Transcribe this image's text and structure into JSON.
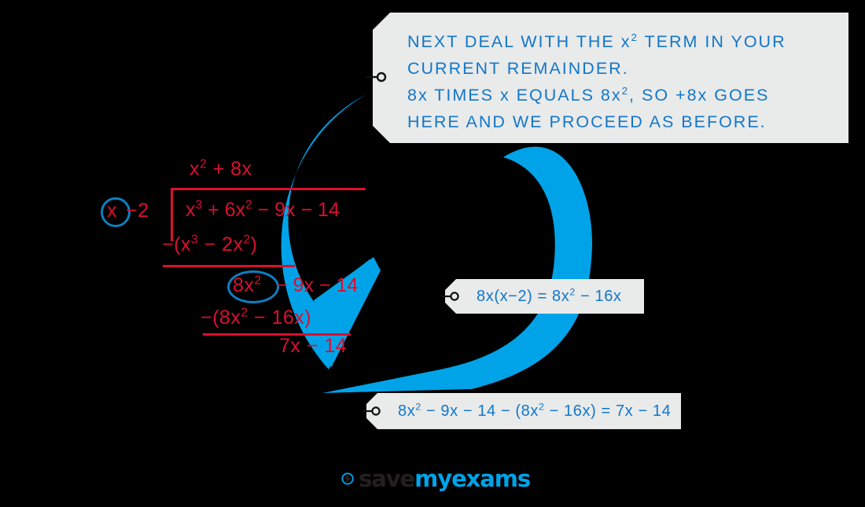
{
  "theme": {
    "background": "#000000",
    "math_red": "#D81030",
    "accent_blue": "#00A3E8",
    "circle_blue": "#0E7FC1",
    "tag_background": "#E9EAEA",
    "tag_text_blue": "#1277C8"
  },
  "division": {
    "divisor": "x − 2",
    "divisor_circled_part": "x",
    "divisor_rest": "−2",
    "quotient": "x² + 8x",
    "dividend": "x³ + 6x² − 9x − 14",
    "subtract_step_1": "−(x³ − 2x²)",
    "remainder_1_circled": "8x²",
    "remainder_1_rest": "− 9x − 14",
    "subtract_step_2": "−(8x² − 16x)",
    "remainder_2": "7x − 14"
  },
  "callouts": {
    "main": {
      "line1": "NEXT DEAL WITH THE x² TERM IN  YOUR",
      "line2": "CURRENT  REMAINDER.",
      "line3": "8x TIMES x EQUALS 8x², SO +8x GOES",
      "line4": "HERE AND  WE PROCEED AS BEFORE."
    },
    "multiply": "8x(x−2) = 8x² − 16x",
    "subtract": "8x² − 9x − 14 − (8x² − 16x) = 7x − 14"
  },
  "logo": {
    "word_1": "save",
    "word_2": "my",
    "word_3": "exams"
  }
}
